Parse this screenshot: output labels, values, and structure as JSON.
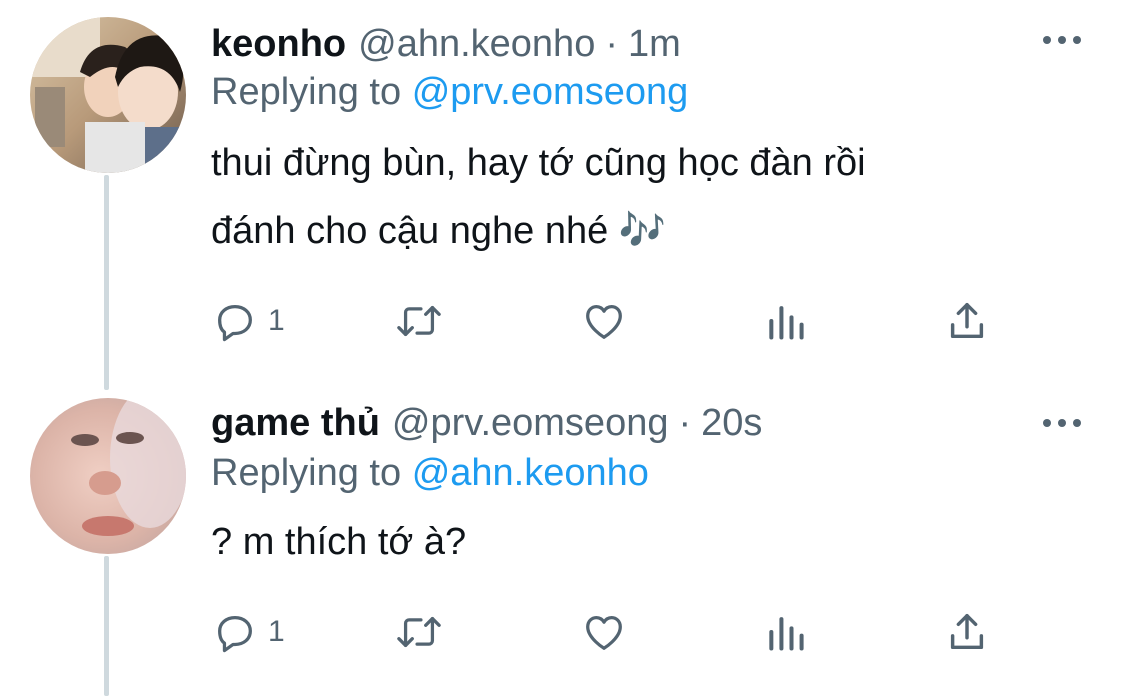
{
  "tweets": [
    {
      "display_name": "keonho",
      "handle": "@ahn.keonho",
      "separator": "·",
      "time": "1m",
      "replying_prefix": "Replying to",
      "replying_to": "@prv.eomseong",
      "text_lines": [
        "thui đừng bùn, hay tớ cũng học đàn rồi",
        "đánh cho cậu nghe nhé 🎶"
      ],
      "reply_count": "1",
      "icons": {
        "reply": "reply-icon",
        "retweet": "retweet-icon",
        "like": "heart-icon",
        "views": "analytics-icon",
        "share": "share-icon",
        "more": "more-icon"
      }
    },
    {
      "display_name": "game thủ",
      "handle": "@prv.eomseong",
      "separator": "·",
      "time": "20s",
      "replying_prefix": "Replying to",
      "replying_to": "@ahn.keonho",
      "text_lines": [
        "? m thích tớ à?"
      ],
      "reply_count": "1",
      "icons": {
        "reply": "reply-icon",
        "retweet": "retweet-icon",
        "like": "heart-icon",
        "views": "analytics-icon",
        "share": "share-icon",
        "more": "more-icon"
      }
    }
  ],
  "colors": {
    "text_primary": "#0f1419",
    "text_secondary": "#536471",
    "link": "#1d9bf0",
    "thread_line": "#cfd9de",
    "background": "#ffffff"
  }
}
